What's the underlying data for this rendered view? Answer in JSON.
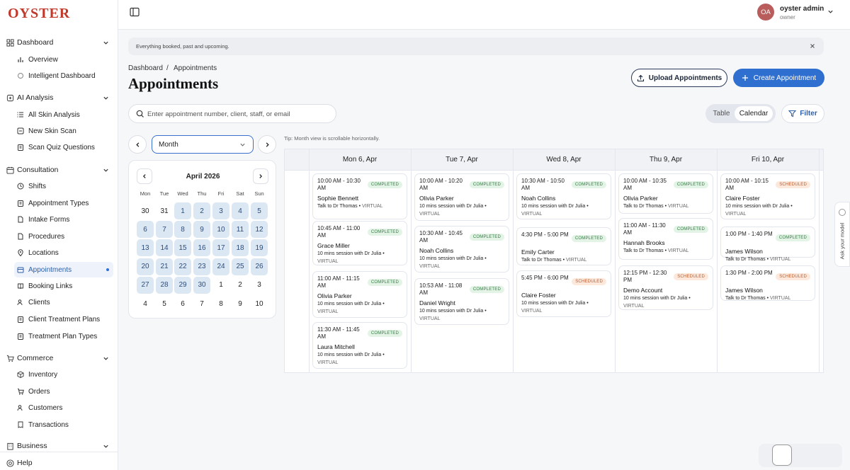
{
  "app": {
    "logo": "OYSTER"
  },
  "user": {
    "initials": "OA",
    "name": "oyster admin",
    "role": "owner"
  },
  "sidebar": {
    "sections": [
      {
        "label": "Dashboard",
        "items": [
          "Overview",
          "Intelligent Dashboard"
        ]
      },
      {
        "label": "AI Analysis",
        "items": [
          "All Skin Analysis",
          "New Skin Scan",
          "Scan Quiz Questions"
        ]
      },
      {
        "label": "Consultation",
        "items": [
          "Shifts",
          "Appointment Types",
          "Intake Forms",
          "Procedures",
          "Locations",
          "Appointments",
          "Booking Links",
          "Clients",
          "Client Treatment Plans",
          "Treatment Plan Types"
        ]
      },
      {
        "label": "Commerce",
        "items": [
          "Inventory",
          "Orders",
          "Customers",
          "Transactions"
        ]
      },
      {
        "label": "Business",
        "items": []
      }
    ],
    "help": "Help",
    "active_item": "Appointments"
  },
  "banner": {
    "text": "Everything booked, past and upcoming."
  },
  "breadcrumb": {
    "root": "Dashboard",
    "separator": "/",
    "current": "Appointments"
  },
  "page": {
    "title": "Appointments"
  },
  "actions": {
    "upload": "Upload Appointments",
    "create": "Create Appointment",
    "filter": "Filter"
  },
  "search": {
    "placeholder": "Enter appointment number, client, staff, or email",
    "value": ""
  },
  "view_toggle": {
    "options": [
      "Table",
      "Calendar"
    ],
    "selected": "Calendar"
  },
  "range_select": {
    "value": "Month"
  },
  "tip": "Tip: Month view is scrollable horizontally.",
  "mini_calendar": {
    "title": "April 2026",
    "weekdays": [
      "Mon",
      "Tue",
      "Wed",
      "Thu",
      "Fri",
      "Sat",
      "Sun"
    ],
    "weeks": [
      [
        "30",
        "31",
        "1",
        "2",
        "3",
        "4",
        "5"
      ],
      [
        "6",
        "7",
        "8",
        "9",
        "10",
        "11",
        "12"
      ],
      [
        "13",
        "14",
        "15",
        "16",
        "17",
        "18",
        "19"
      ],
      [
        "20",
        "21",
        "22",
        "23",
        "24",
        "25",
        "26"
      ],
      [
        "27",
        "28",
        "29",
        "30",
        "1",
        "2",
        "3"
      ],
      [
        "4",
        "5",
        "6",
        "7",
        "8",
        "9",
        "10"
      ]
    ],
    "in_month_flags": [
      [
        false,
        false,
        true,
        true,
        true,
        true,
        true
      ],
      [
        true,
        true,
        true,
        true,
        true,
        true,
        true
      ],
      [
        true,
        true,
        true,
        true,
        true,
        true,
        true
      ],
      [
        true,
        true,
        true,
        true,
        true,
        true,
        true
      ],
      [
        true,
        true,
        true,
        true,
        false,
        false,
        false
      ],
      [
        false,
        false,
        false,
        false,
        false,
        false,
        false
      ]
    ]
  },
  "week": {
    "days": [
      {
        "label": "Mon 6, Apr",
        "appointments": [
          {
            "time": "10:00 AM - 10:30 AM",
            "status": "COMPLETED",
            "name": "Sophie Bennett",
            "desc": "Talk to Dr Thomas",
            "mode": "VIRTUAL"
          },
          {
            "time": "10:45 AM - 11:00 AM",
            "status": "COMPLETED",
            "name": "Grace Miller",
            "desc": "10 mins session with Dr Julia",
            "mode": "VIRTUAL"
          },
          {
            "time": "11:00 AM - 11:15 AM",
            "status": "COMPLETED",
            "name": "Olivia Parker",
            "desc": "10 mins session with Dr Julia",
            "mode": "VIRTUAL"
          },
          {
            "time": "11:30 AM - 11:45 AM",
            "status": "COMPLETED",
            "name": "Laura Mitchell",
            "desc": "10 mins session with Dr Julia",
            "mode": "VIRTUAL"
          }
        ]
      },
      {
        "label": "Tue 7, Apr",
        "appointments": [
          {
            "time": "10:00 AM - 10:20 AM",
            "status": "COMPLETED",
            "name": "Olivia Parker",
            "desc": "10 mins session with Dr Julia",
            "mode": "VIRTUAL"
          },
          {
            "time": "10:30 AM - 10:45 AM",
            "status": "COMPLETED",
            "name": "Noah Collins",
            "desc": "10 mins session with Dr Julia",
            "mode": "VIRTUAL"
          },
          {
            "time": "10:53 AM - 11:08 AM",
            "status": "COMPLETED",
            "name": "Daniel Wright",
            "desc": "10 mins session with Dr Julia",
            "mode": "VIRTUAL"
          }
        ]
      },
      {
        "label": "Wed 8, Apr",
        "appointments": [
          {
            "time": "10:30 AM - 10:50 AM",
            "status": "COMPLETED",
            "name": "Noah Collins",
            "desc": "10 mins session with Dr Julia",
            "mode": "VIRTUAL"
          },
          {
            "time": "4:30 PM - 5:00 PM",
            "status": "COMPLETED",
            "name": "Emily Carter",
            "desc": "Talk to Dr Thomas",
            "mode": "VIRTUAL"
          },
          {
            "time": "5:45 PM - 6:00 PM",
            "status": "SCHEDULED",
            "name": "Claire Foster",
            "desc": "10 mins session with Dr Julia",
            "mode": "VIRTUAL"
          }
        ]
      },
      {
        "label": "Thu 9, Apr",
        "appointments": [
          {
            "time": "10:00 AM - 10:35 AM",
            "status": "COMPLETED",
            "name": "Olivia Parker",
            "desc": "Talk to Dr Thomas",
            "mode": "VIRTUAL"
          },
          {
            "time": "11:00 AM - 11:30 AM",
            "status": "COMPLETED",
            "name": "Hannah Brooks",
            "desc": "Talk to Dr Thomas",
            "mode": "VIRTUAL"
          },
          {
            "time": "12:15 PM - 12:30 PM",
            "status": "SCHEDULED",
            "name": "Demo Account",
            "desc": "10 mins session with Dr Julia",
            "mode": "VIRTUAL"
          }
        ]
      },
      {
        "label": "Fri 10, Apr",
        "appointments": [
          {
            "time": "10:00 AM - 10:15 AM",
            "status": "SCHEDULED",
            "name": "Claire Foster",
            "desc": "10 mins session with Dr Julia",
            "mode": "VIRTUAL"
          },
          {
            "time": "1:00 PM - 1:40 PM",
            "status": "COMPLETED",
            "name": "James Wilson",
            "desc": "Talk to Dr Thomas",
            "mode": "VIRTUAL"
          },
          {
            "time": "1:30 PM - 2:00 PM",
            "status": "SCHEDULED",
            "name": "James Wilson",
            "desc": "Talk to Dr Thomas",
            "mode": "VIRTUAL"
          }
        ]
      }
    ]
  },
  "ask_widget": {
    "label": "Ask your model"
  },
  "colors": {
    "accent": "#2f6fcf",
    "brand": "#c0392b",
    "completed": "#2e7d3f",
    "scheduled": "#c0592a"
  }
}
